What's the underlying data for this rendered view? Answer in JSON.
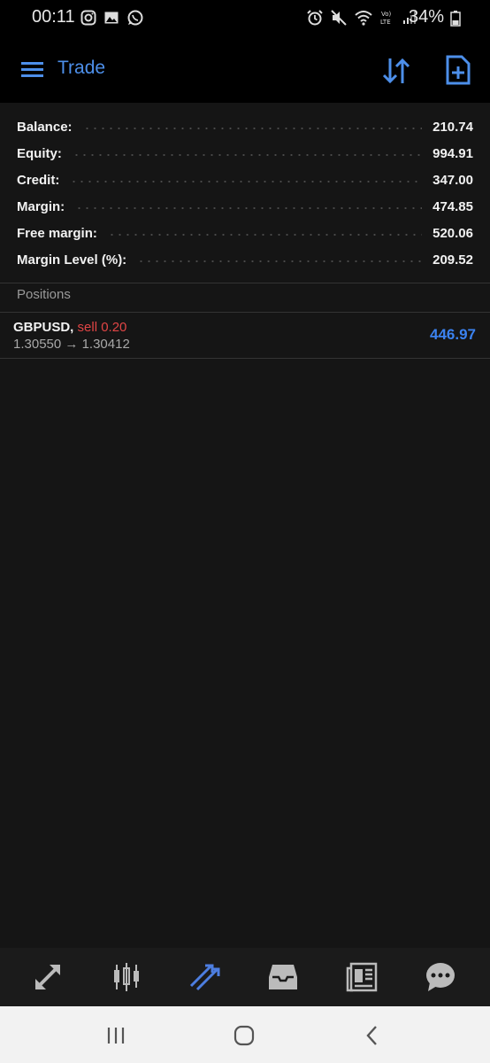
{
  "status_bar": {
    "time": "00:11",
    "battery": "34%"
  },
  "app_bar": {
    "title": "Trade"
  },
  "summary": [
    {
      "label": "Balance:",
      "value": "210.74"
    },
    {
      "label": "Equity:",
      "value": "994.91"
    },
    {
      "label": "Credit:",
      "value": "347.00"
    },
    {
      "label": "Margin:",
      "value": "474.85"
    },
    {
      "label": "Free margin:",
      "value": "520.06"
    },
    {
      "label": "Margin Level (%):",
      "value": "209.52"
    }
  ],
  "positions": {
    "header": "Positions",
    "items": [
      {
        "symbol": "GBPUSD,",
        "side": "sell 0.20",
        "open_price": "1.30550",
        "arrow": "→",
        "current_price": "1.30412",
        "profit": "446.97"
      }
    ]
  },
  "colors": {
    "accent": "#4d8fea",
    "sell": "#e04545",
    "profit": "#3b82f0",
    "background": "#151515"
  },
  "icons": {
    "bottom_nav": [
      "quotes-icon",
      "chart-icon",
      "trade-icon",
      "history-icon",
      "news-icon",
      "chat-icon"
    ],
    "active_tab": "trade-icon"
  }
}
